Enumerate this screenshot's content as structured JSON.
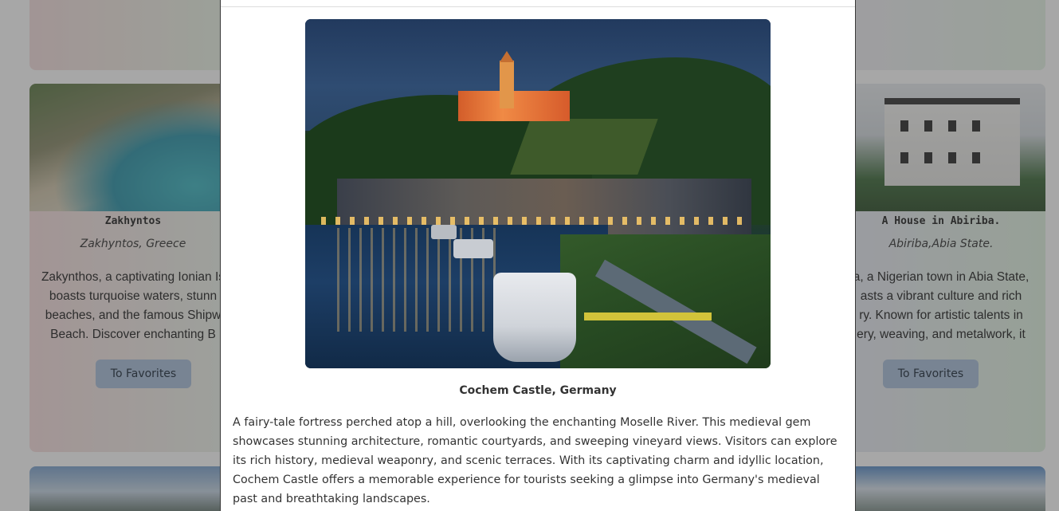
{
  "cards": {
    "left": {
      "title": "Zakhyntos",
      "location": "Zakhyntos, Greece",
      "description": "Zakynthos, a captivating Ionian Is\nboasts turquoise waters, stunn\nbeaches, and the famous Shipw\nBeach. Discover enchanting B",
      "button": "To Favorites"
    },
    "right": {
      "title": "A House in Abiriba.",
      "location": "Abiriba,Abia State.",
      "description": "a, a Nigerian town in Abia State,\nasts a vibrant culture and rich\nry. Known for artistic talents in\nery, weaving, and metalwork, it",
      "button": "To Favorites"
    }
  },
  "modal": {
    "caption": "Cochem Castle, Germany",
    "description": "A fairy-tale fortress perched atop a hill, overlooking the enchanting Moselle River. This medieval gem showcases stunning architecture, romantic courtyards, and sweeping vineyard views. Visitors can explore its rich history, medieval weaponry, and scenic terraces. With its captivating charm and idyllic location, Cochem Castle offers a memorable experience for tourists seeking a glimpse into Germany's medieval past and breathtaking landscapes."
  }
}
